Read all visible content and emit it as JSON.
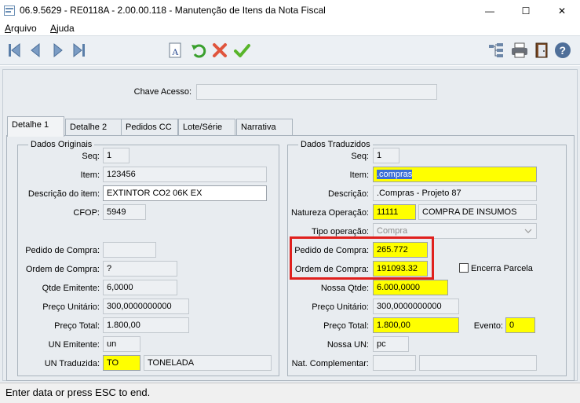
{
  "window": {
    "title": "06.9.5629 - RE0118A - 2.00.00.118 - Manutenção de Itens da Nota Fiscal",
    "minimize": "—",
    "maximize": "☐",
    "close": "✕"
  },
  "menu": {
    "file": "Arquivo",
    "help": "Ajuda"
  },
  "toolbar": {
    "icons": [
      "first-record-icon",
      "prev-record-icon",
      "next-record-icon",
      "last-record-icon",
      "font-icon",
      "undo-icon",
      "cancel-icon",
      "confirm-icon",
      "tree-icon",
      "print-icon",
      "exit-icon",
      "help-icon"
    ]
  },
  "header": {
    "chave_acesso_label": "Chave Acesso:",
    "chave_acesso_value": ""
  },
  "tabs": [
    "Detalhe 1",
    "Detalhe 2",
    "Pedidos CC",
    "Lote/Série",
    "Narrativa"
  ],
  "dados_originais": {
    "title": "Dados Originais",
    "seq_label": "Seq:",
    "seq": "1",
    "item_label": "Item:",
    "item": "123456",
    "descricao_label": "Descrição do item:",
    "descricao": "EXTINTOR CO2 06K EX",
    "cfop_label": "CFOP:",
    "cfop": "5949",
    "pedido_label": "Pedido de Compra:",
    "pedido": "",
    "ordem_label": "Ordem de Compra:",
    "ordem": "?",
    "qtde_label": "Qtde Emitente:",
    "qtde": "6,0000",
    "preco_unit_label": "Preço Unitário:",
    "preco_unit": "300,0000000000",
    "preco_total_label": "Preço Total:",
    "preco_total": "1.800,00",
    "un_emitente_label": "UN Emitente:",
    "un_emitente": "un",
    "un_traduzida_label": "UN Traduzida:",
    "un_traduzida": "TO",
    "un_traduzida_desc": "TONELADA"
  },
  "dados_traduzidos": {
    "title": "Dados Traduzidos",
    "seq_label": "Seq:",
    "seq": "1",
    "item_label": "Item:",
    "item": ".compras",
    "descricao_label": "Descrição:",
    "descricao": ".Compras - Projeto 87",
    "natureza_label": "Natureza Operação:",
    "natureza": "11111",
    "natureza_desc": "COMPRA DE INSUMOS",
    "tipo_label": "Tipo operação:",
    "tipo": "Compra",
    "pedido_label": "Pedido de Compra:",
    "pedido": "265.772",
    "ordem_label": "Ordem de Compra:",
    "ordem": "191093.32",
    "encerra_label": "Encerra Parcela",
    "nossa_qtde_label": "Nossa Qtde:",
    "nossa_qtde": "6.000,0000",
    "preco_unit_label": "Preço Unitário:",
    "preco_unit": "300,0000000000",
    "preco_total_label": "Preço Total:",
    "preco_total": "1.800,00",
    "evento_label": "Evento:",
    "evento": "0",
    "nossa_un_label": "Nossa UN:",
    "nossa_un": "pc",
    "nat_comp_label": "Nat. Complementar:",
    "nat_comp": "",
    "nat_comp_desc": ""
  },
  "status": {
    "text": "Enter data or press ESC to end."
  }
}
